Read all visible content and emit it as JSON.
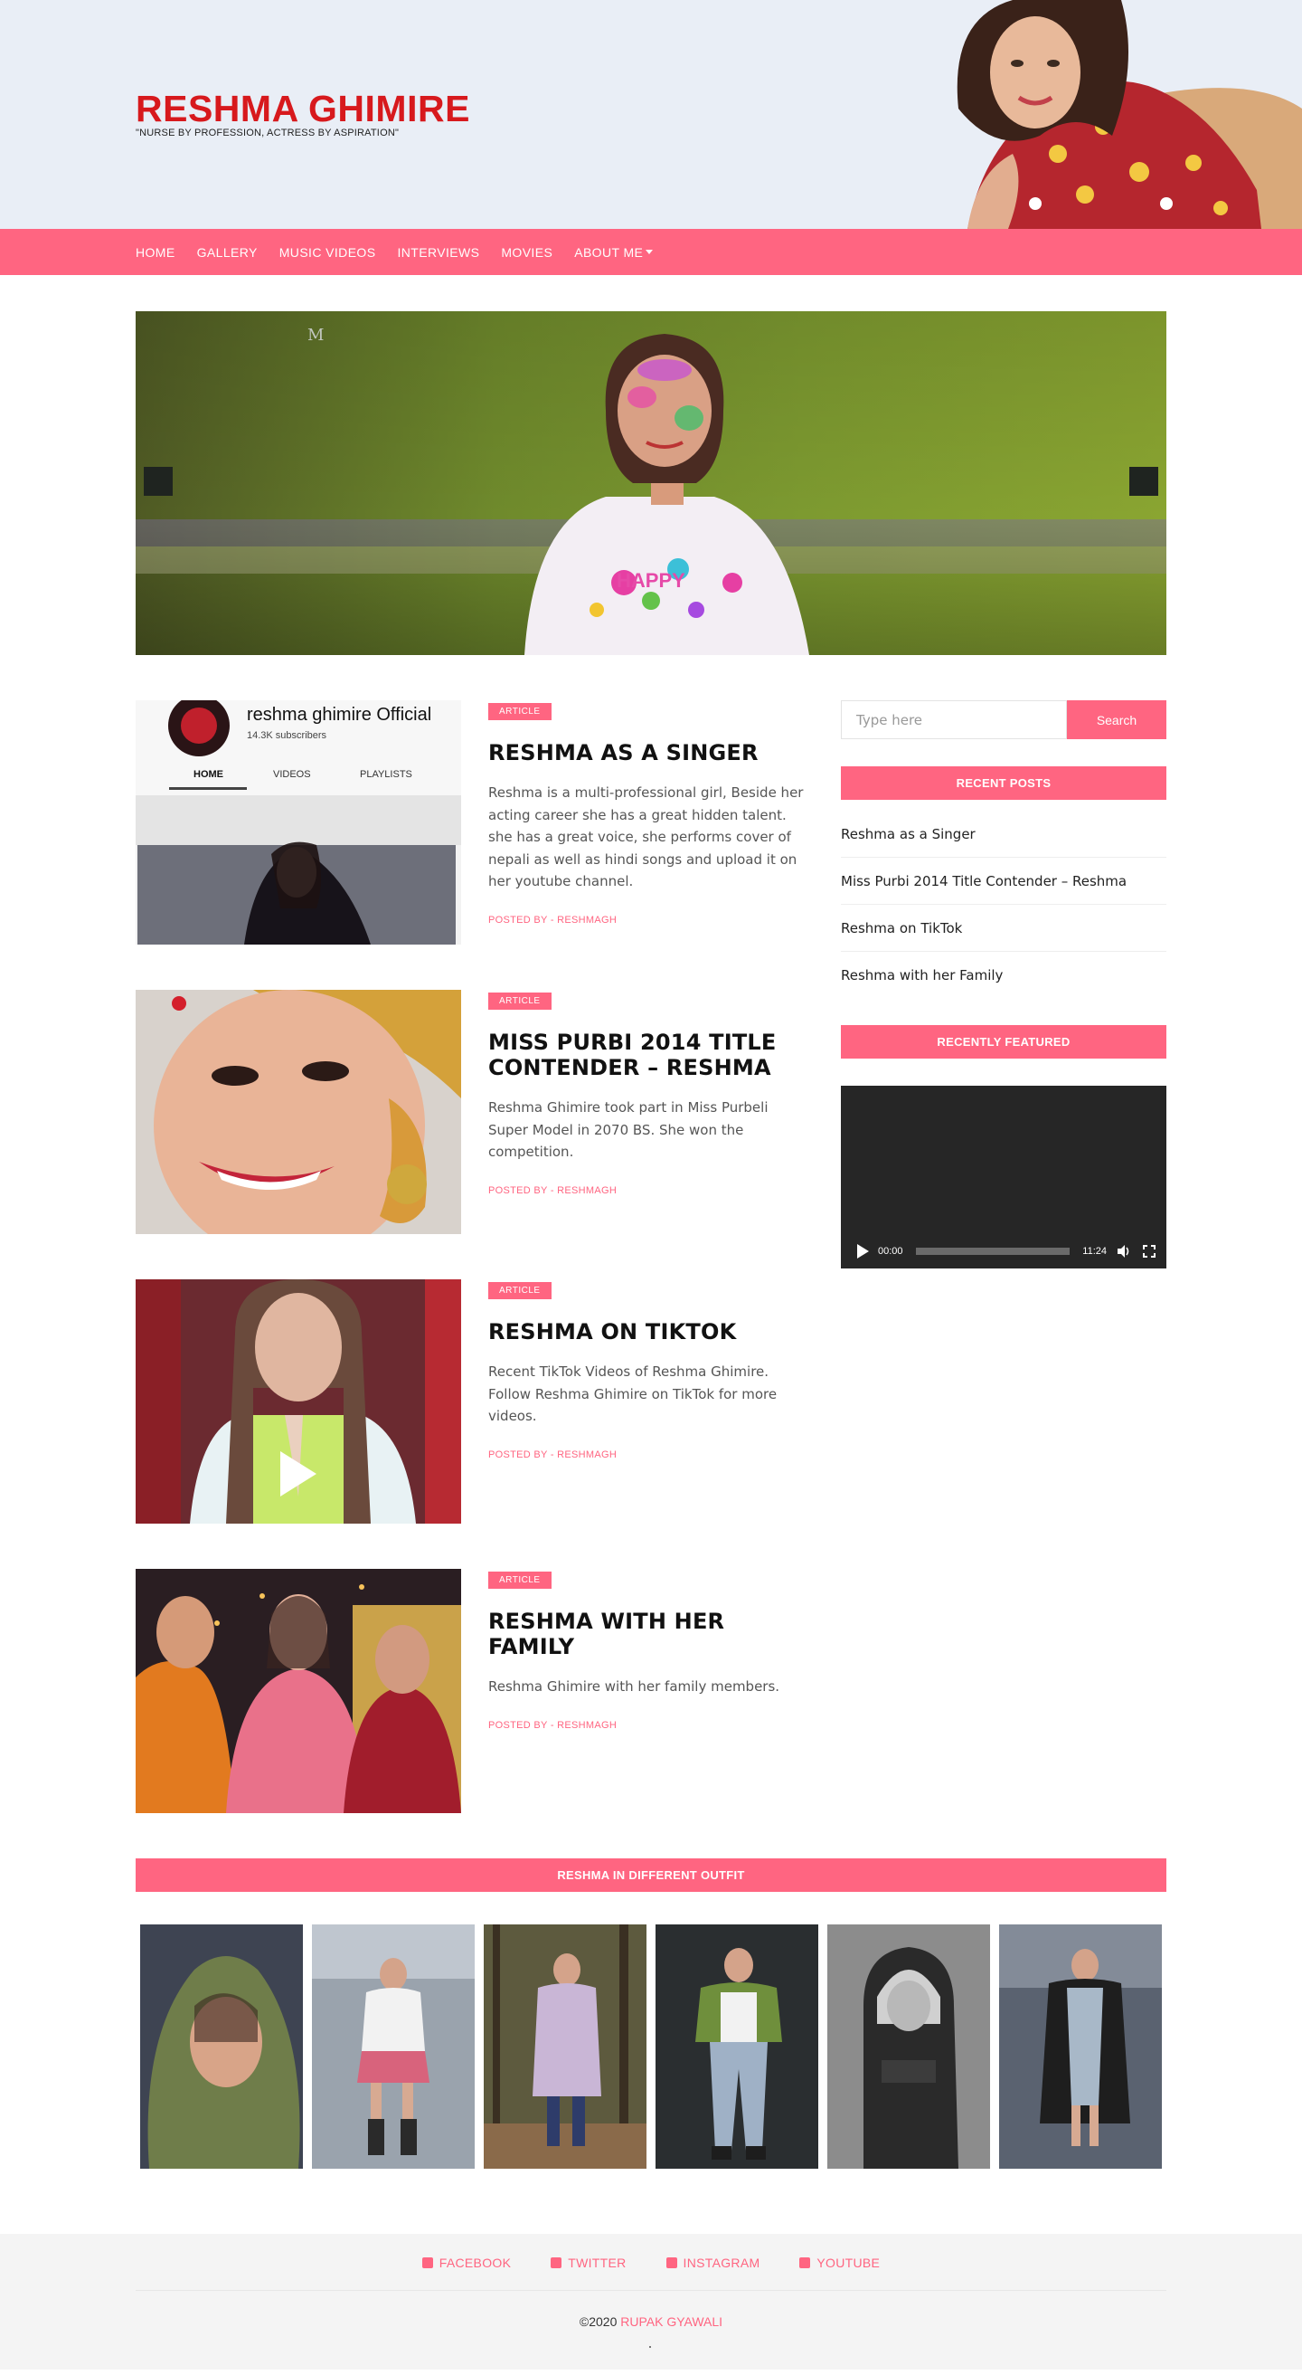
{
  "site": {
    "title": "RESHMA GHIMIRE",
    "tagline": "\"NURSE BY PROFESSION, ACTRESS BY ASPIRATION\""
  },
  "nav": {
    "items": [
      "HOME",
      "GALLERY",
      "MUSIC VIDEOS",
      "INTERVIEWS",
      "MOVIES"
    ],
    "dropdown_label": "ABOUT ME"
  },
  "youtube_card": {
    "channel": "reshma ghimire Official",
    "subscribers": "14.3K subscribers",
    "tabs": [
      "HOME",
      "VIDEOS",
      "PLAYLISTS"
    ]
  },
  "posts": [
    {
      "badge": "ARTICLE",
      "title": "RESHMA AS A SINGER",
      "excerpt": "Reshma is a multi-professional girl, Beside her acting career she has a great hidden talent. she has a great voice, she performs cover of nepali as well as hindi songs and upload it on her youtube channel.",
      "meta": "POSTED BY - RESHMAGH"
    },
    {
      "badge": "ARTICLE",
      "title": "MISS PURBI 2014 TITLE CONTENDER – RESHMA",
      "excerpt": "Reshma Ghimire took part in Miss Purbeli Super Model in 2070 BS. She won the competition.",
      "meta": "POSTED BY - RESHMAGH"
    },
    {
      "badge": "ARTICLE",
      "title": "RESHMA ON TIKTOK",
      "excerpt": "Recent TikTok Videos of Reshma Ghimire. Follow Reshma Ghimire on TikTok for more videos.",
      "meta": "POSTED BY - RESHMAGH"
    },
    {
      "badge": "ARTICLE",
      "title": "RESHMA WITH HER FAMILY",
      "excerpt": "Reshma Ghimire with her family members.",
      "meta": "POSTED BY - RESHMAGH"
    }
  ],
  "sidebar": {
    "search_placeholder": "Type here",
    "search_button": "Search",
    "recent_posts_heading": "RECENT POSTS",
    "recent_posts": [
      "Reshma as a Singer",
      "Miss Purbi 2014 Title Contender – Reshma",
      "Reshma on TikTok",
      "Reshma with her Family"
    ],
    "featured_heading": "RECENTLY FEATURED",
    "video": {
      "current_time": "00:00",
      "duration": "11:24"
    }
  },
  "outfits": {
    "heading": "RESHMA IN DIFFERENT OUTFIT"
  },
  "footer": {
    "social": [
      {
        "label": "FACEBOOK",
        "icon": "facebook-icon"
      },
      {
        "label": "TWITTER",
        "icon": "twitter-icon"
      },
      {
        "label": "INSTAGRAM",
        "icon": "instagram-icon"
      },
      {
        "label": "YOUTUBE",
        "icon": "youtube-icon"
      }
    ],
    "copyright_prefix": "©2020",
    "copyright_author": "RUPAK GYAWALI"
  },
  "colors": {
    "accent": "#ff6581",
    "brand_red": "#d7191d",
    "header_bg": "#e9eef6"
  }
}
